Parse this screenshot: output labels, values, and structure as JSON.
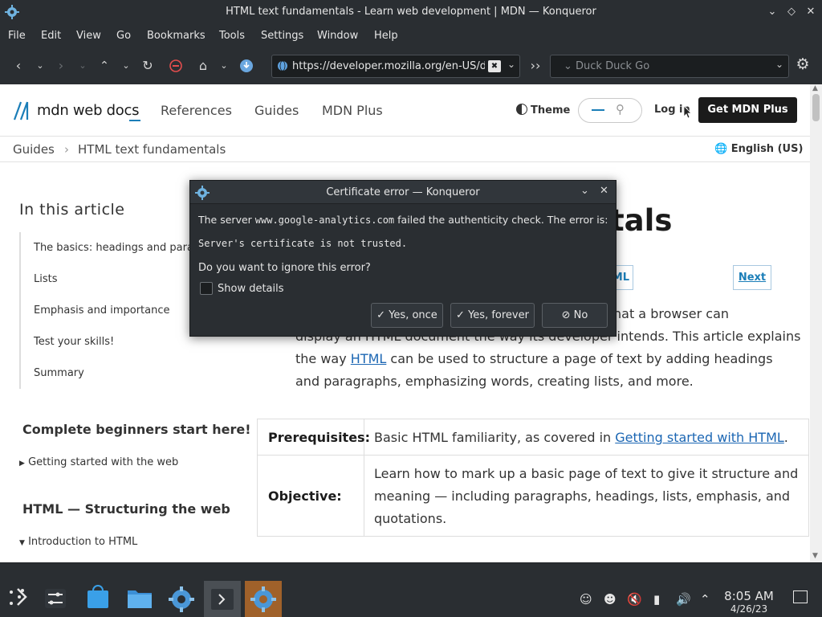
{
  "window": {
    "title": "HTML text fundamentals - Learn web development | MDN — Konqueror"
  },
  "menu": [
    "File",
    "Edit",
    "View",
    "Go",
    "Bookmarks",
    "Tools",
    "Settings",
    "Window",
    "Help"
  ],
  "toolbar": {
    "url": "https://developer.mozilla.org/en-US/docs/Learn/HTML/Introduction_to_HTML",
    "search_placeholder": "Duck Duck Go"
  },
  "mdn": {
    "logo": "mdn web docs",
    "nav": [
      "References",
      "Guides",
      "MDN Plus"
    ],
    "theme": "Theme",
    "login": "Log in",
    "get_plus": "Get MDN Plus",
    "breadcrumb": [
      "Guides",
      "HTML text fundamentals"
    ],
    "breadcrumb_sep": "›",
    "language": "English (US)",
    "in_this_article": "In this article",
    "toc": [
      "The basics: headings and paragraphs",
      "Lists",
      "Emphasis and importance",
      "Test your skills!",
      "Summary"
    ],
    "side_heading_1": "Complete beginners start here!",
    "side_item_1": "Getting started with the web",
    "side_heading_2": "HTML — Structuring the web",
    "side_item_2": "Introduction to HTML",
    "title_fragment": "tals",
    "prev_fragment": "ML",
    "next": "Next",
    "para_line1": "hat a browser can",
    "para_line2": "display an HTML document the way its developer intends. This article explains",
    "para_line3_before": "the way ",
    "para_line3_link": "HTML",
    "para_line3_after": " can be used to structure a page of text by adding headings",
    "para_line4": "and paragraphs, emphasizing words, creating lists, and more.",
    "prereq_label": "Prerequisites:",
    "prereq_before": "Basic HTML familiarity, as covered in ",
    "prereq_link": "Getting started with HTML",
    "prereq_after": ".",
    "objective_label": "Objective:",
    "objective_lines": [
      "Learn how to mark up a basic page of text to give it structure and",
      "meaning — including paragraphs, headings, lists, emphasis, and",
      "quotations."
    ]
  },
  "dialog": {
    "title": "Certificate error — Konqueror",
    "msg_before": "The server ",
    "msg_host": "www.google-analytics.com",
    "msg_after": " failed the authenticity check. The error is:",
    "error": "Server's certificate is not trusted.",
    "question": "Do you want to ignore this error?",
    "show_details": "Show details",
    "btn_once": "Yes, once",
    "btn_forever": "Yes, forever",
    "btn_no": "No"
  },
  "taskbar": {
    "time": "8:05 AM",
    "date": "4/26/23"
  }
}
